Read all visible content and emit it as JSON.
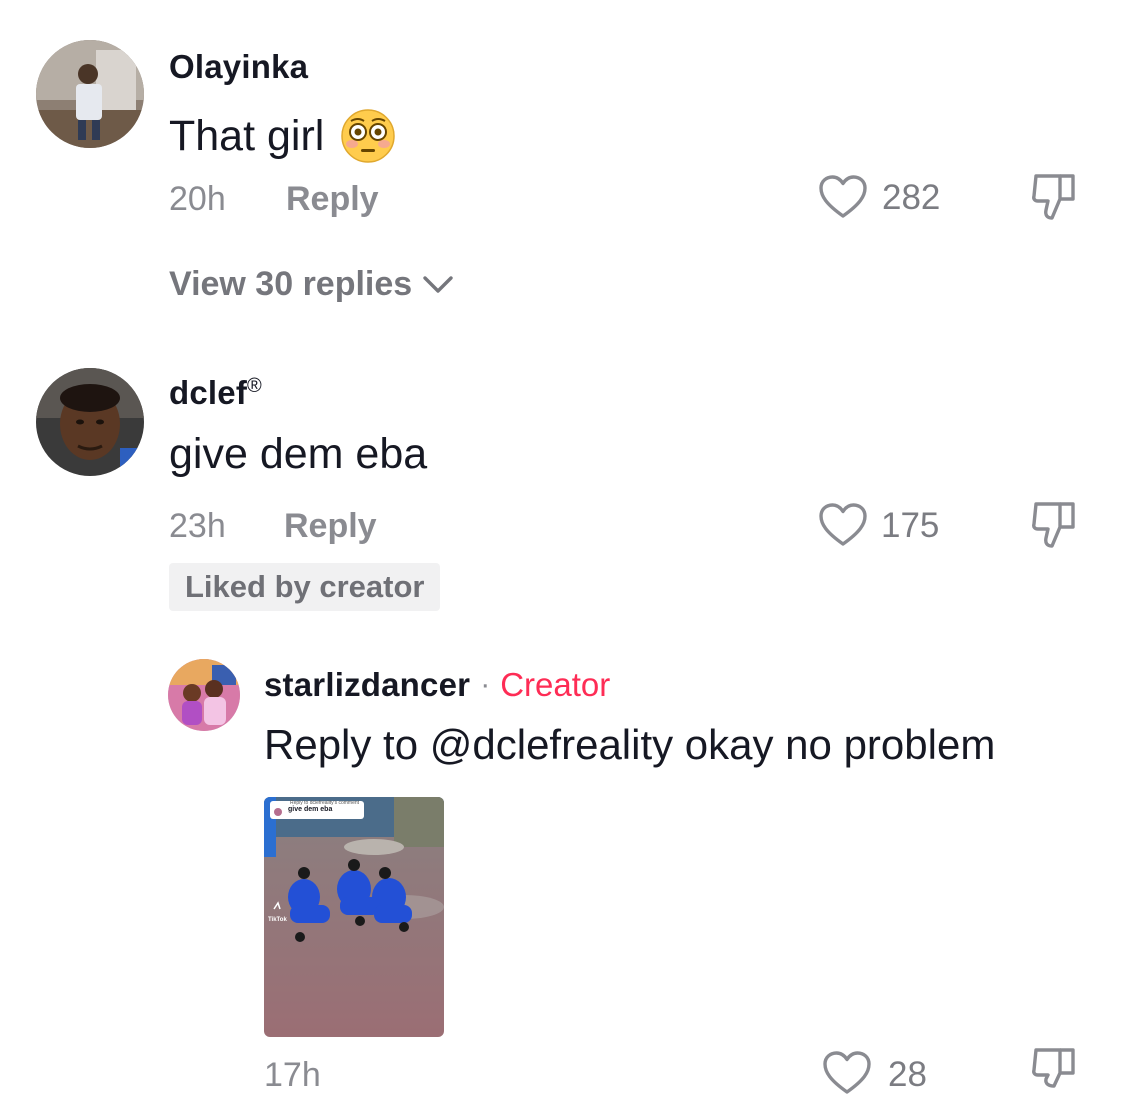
{
  "comments": [
    {
      "username": "Olayinka",
      "text": "That girl",
      "emoji": "😳",
      "time": "20h",
      "reply_label": "Reply",
      "likes": "282",
      "view_replies": "View 30 replies"
    },
    {
      "username": "dclef",
      "verified_mark": "®",
      "text": "give dem eba",
      "time": "23h",
      "reply_label": "Reply",
      "likes": "175",
      "liked_by_creator": "Liked by creator"
    }
  ],
  "reply": {
    "username": "starlizdancer",
    "separator": "·",
    "creator_tag": "Creator",
    "text": "Reply to @dclefreality okay no problem",
    "video_thumbnail": {
      "header_small": "Reply to dclefreality's comment",
      "header_text": "give dem eba",
      "watermark": "TikTok"
    },
    "time": "17h",
    "likes": "28"
  },
  "colors": {
    "creator_accent": "#fe2c55",
    "secondary_text": "#8a8b91"
  },
  "icons": [
    "heart-icon",
    "dislike-icon",
    "chevron-down-icon",
    "flushed-face-emoji"
  ]
}
